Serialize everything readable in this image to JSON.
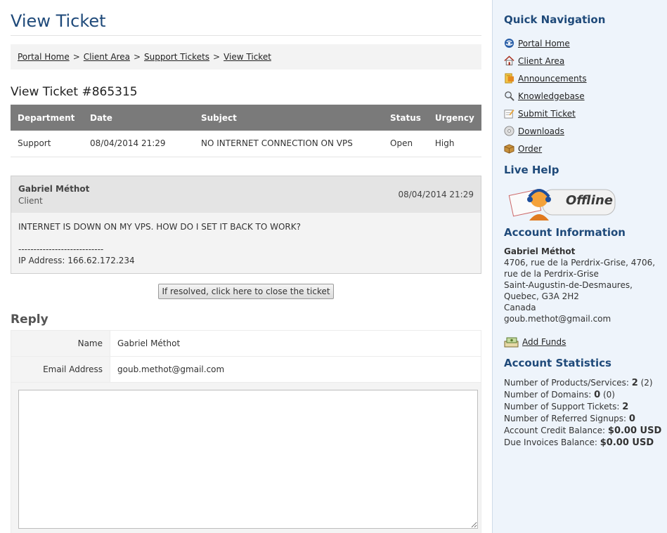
{
  "page": {
    "title": "View Ticket"
  },
  "breadcrumb": [
    {
      "label": "Portal Home"
    },
    {
      "label": "Client Area"
    },
    {
      "label": "Support Tickets"
    },
    {
      "label": "View Ticket"
    }
  ],
  "breadcrumb_separator": ">",
  "ticket": {
    "heading": "View Ticket #865315",
    "columns": [
      "Department",
      "Date",
      "Subject",
      "Status",
      "Urgency"
    ],
    "row": {
      "department": "Support",
      "date": "08/04/2014 21:29",
      "subject": "NO INTERNET CONNECTION ON VPS",
      "status": "Open",
      "urgency": "High"
    }
  },
  "message": {
    "author": "Gabriel Méthot",
    "role": "Client",
    "date": "08/04/2014 21:29",
    "body": "INTERNET IS DOWN ON MY VPS. HOW DO I SET IT BACK TO WORK?",
    "signature_line": "----------------------------",
    "ip": "IP Address: 166.62.172.234"
  },
  "close_button": "If resolved, click here to close the ticket",
  "reply": {
    "title": "Reply",
    "name_label": "Name",
    "name_value": "Gabriel Méthot",
    "email_label": "Email Address",
    "email_value": "goub.methot@gmail.com",
    "message_value": ""
  },
  "sidebar": {
    "quick_nav_title": "Quick Navigation",
    "nav_items": [
      {
        "label": "Portal Home",
        "icon": "globe-icon"
      },
      {
        "label": "Client Area",
        "icon": "home-icon"
      },
      {
        "label": "Announcements",
        "icon": "announcement-icon"
      },
      {
        "label": "Knowledgebase",
        "icon": "magnifier-icon"
      },
      {
        "label": "Submit Ticket",
        "icon": "ticket-edit-icon"
      },
      {
        "label": "Downloads",
        "icon": "disc-icon"
      },
      {
        "label": "Order",
        "icon": "box-icon"
      }
    ],
    "live_help_title": "Live Help",
    "live_help_status": "Offline",
    "account_info_title": "Account Information",
    "account": {
      "name": "Gabriel Méthot",
      "address1": "4706, rue de la Perdrix-Grise, 4706,",
      "address2": "rue de la Perdrix-Grise",
      "city": "Saint-Augustin-de-Desmaures,",
      "region": "Quebec, G3A 2H2",
      "country": "Canada",
      "email": "goub.methot@gmail.com"
    },
    "add_funds": "Add Funds",
    "stats_title": "Account Statistics",
    "stats": [
      {
        "label": "Number of Products/Services:",
        "value": "2",
        "extra": "(2)"
      },
      {
        "label": "Number of Domains:",
        "value": "0",
        "extra": "(0)"
      },
      {
        "label": "Number of Support Tickets:",
        "value": "2",
        "extra": ""
      },
      {
        "label": "Number of Referred Signups:",
        "value": "0",
        "extra": ""
      },
      {
        "label": "Account Credit Balance:",
        "value": "$0.00 USD",
        "extra": ""
      },
      {
        "label": "Due Invoices Balance:",
        "value": "$0.00 USD",
        "extra": ""
      }
    ]
  },
  "colors": {
    "title": "#1f4a7a",
    "header_bg": "#7a7a7a",
    "open_status": "#779500",
    "sidebar_bg": "#eef4fb"
  }
}
